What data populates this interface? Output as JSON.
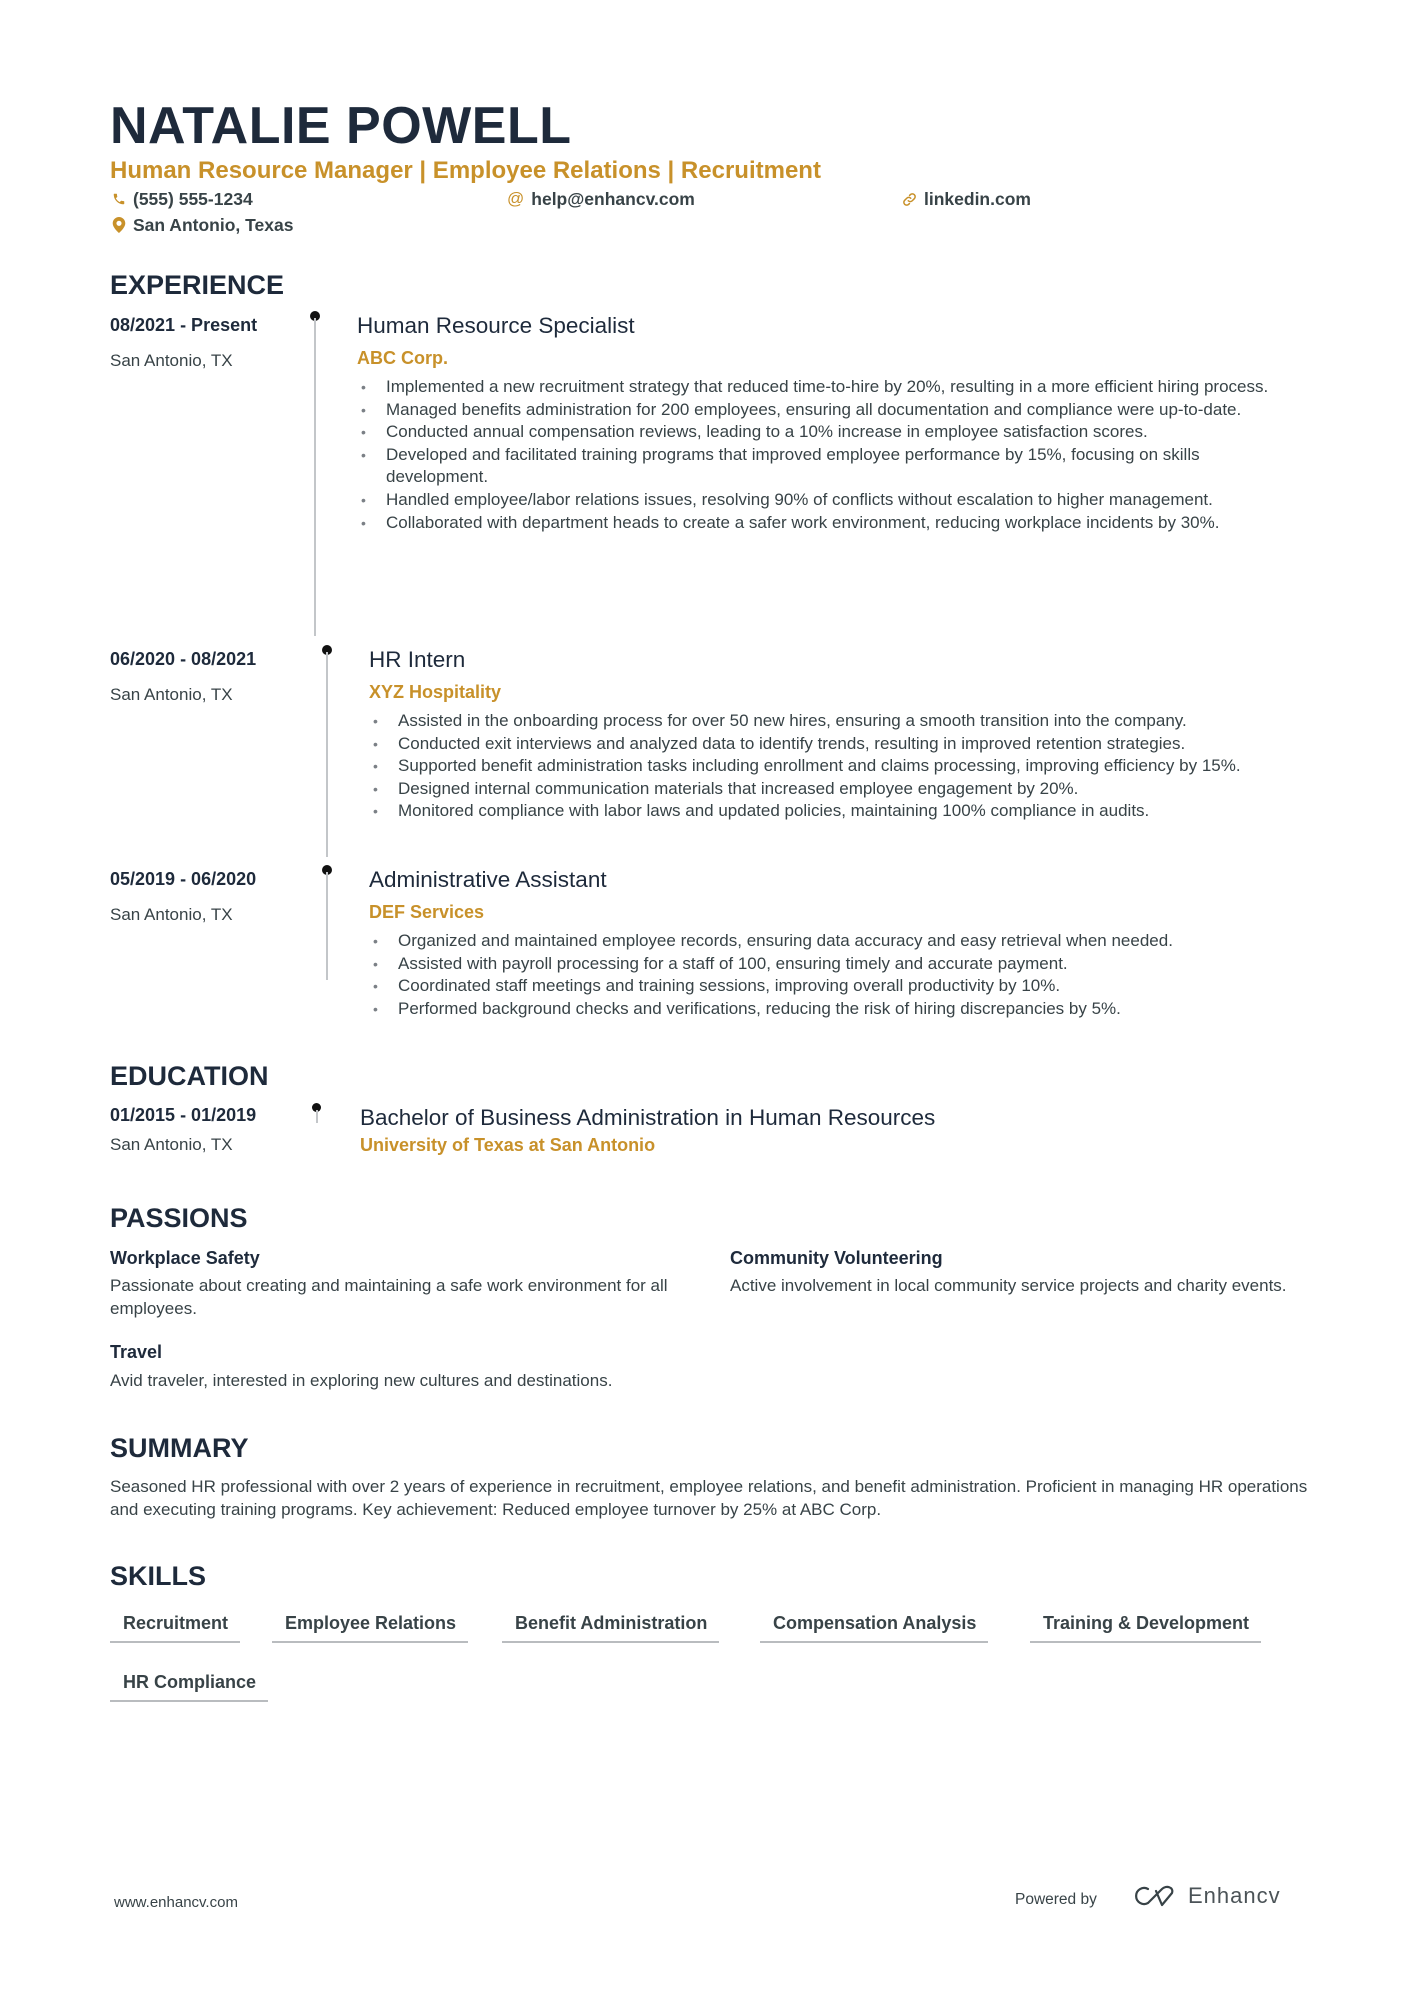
{
  "header": {
    "name": "NATALIE POWELL",
    "headline": "Human Resource Manager | Employee Relations | Recruitment",
    "phone": "(555) 555-1234",
    "email": "help@enhancv.com",
    "website": "linkedin.com",
    "location": "San Antonio, Texas"
  },
  "colors": {
    "accent": "#c8912a",
    "heading": "#1e2a3b",
    "text": "#384347"
  },
  "experience": {
    "title": "EXPERIENCE",
    "items": [
      {
        "date": "08/2021 - Present",
        "location": "San Antonio, TX",
        "role": "Human Resource Specialist",
        "company": "ABC Corp.",
        "bullets": [
          "Implemented a new recruitment strategy that reduced time-to-hire by 20%, resulting in a more efficient hiring process.",
          "Managed benefits administration for 200 employees, ensuring all documentation and compliance were up-to-date.",
          "Conducted annual compensation reviews, leading to a 10% increase in employee satisfaction scores.",
          "Developed and facilitated training programs that improved employee performance by 15%, focusing on skills development.",
          "Handled employee/labor relations issues, resolving 90% of conflicts without escalation to higher management.",
          "Collaborated with department heads to create a safer work environment, reducing workplace incidents by 30%."
        ]
      },
      {
        "date": "06/2020 - 08/2021",
        "location": "San Antonio, TX",
        "role": "HR Intern",
        "company": "XYZ Hospitality",
        "bullets": [
          "Assisted in the onboarding process for over 50 new hires, ensuring a smooth transition into the company.",
          "Conducted exit interviews and analyzed data to identify trends, resulting in improved retention strategies.",
          "Supported benefit administration tasks including enrollment and claims processing, improving efficiency by 15%.",
          "Designed internal communication materials that increased employee engagement by 20%.",
          "Monitored compliance with labor laws and updated policies, maintaining 100% compliance in audits."
        ]
      },
      {
        "date": "05/2019 - 06/2020",
        "location": "San Antonio, TX",
        "role": "Administrative Assistant",
        "company": "DEF Services",
        "bullets": [
          "Organized and maintained employee records, ensuring data accuracy and easy retrieval when needed.",
          "Assisted with payroll processing for a staff of 100, ensuring timely and accurate payment.",
          "Coordinated staff meetings and training sessions, improving overall productivity by 10%.",
          "Performed background checks and verifications, reducing the risk of hiring discrepancies by 5%."
        ]
      }
    ]
  },
  "education": {
    "title": "EDUCATION",
    "items": [
      {
        "date": "01/2015 - 01/2019",
        "location": "San Antonio, TX",
        "degree": "Bachelor of Business Administration in Human Resources",
        "school": "University of Texas at San Antonio"
      }
    ]
  },
  "passions": {
    "title": "PASSIONS",
    "items": [
      {
        "title": "Workplace Safety",
        "description": "Passionate about creating and maintaining a safe work environment for all employees."
      },
      {
        "title": "Community Volunteering",
        "description": "Active involvement in local community service projects and charity events."
      },
      {
        "title": "Travel",
        "description": "Avid traveler, interested in exploring new cultures and destinations."
      }
    ]
  },
  "summary": {
    "title": "SUMMARY",
    "text": "Seasoned HR professional with over 2 years of experience in recruitment, employee relations, and benefit administration. Proficient in managing HR operations and executing training programs. Key achievement: Reduced employee turnover by 25% at ABC Corp."
  },
  "skills": {
    "title": "SKILLS",
    "items": [
      "Recruitment",
      "Employee Relations",
      "Benefit Administration",
      "Compensation Analysis",
      "Training & Development",
      "HR Compliance"
    ]
  },
  "footer": {
    "website": "www.enhancv.com",
    "powered_by": "Powered by",
    "brand": "Enhancv"
  }
}
